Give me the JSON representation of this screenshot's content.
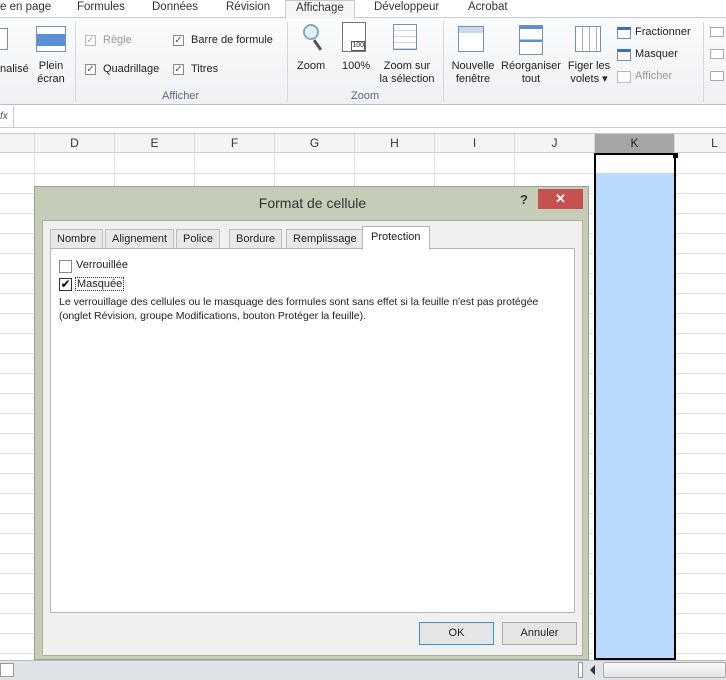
{
  "ribbon_tabs": [
    "e en page",
    "Formules",
    "Données",
    "Révision",
    "Affichage",
    "Développeur",
    "Acrobat"
  ],
  "active_tab": "Affichage",
  "ribbon": {
    "left_group": {
      "partial_label": "nalisé",
      "plein_ecran": [
        "Plein",
        "écran"
      ]
    },
    "afficher": {
      "label": "Afficher",
      "regle": {
        "label": "Règle",
        "checked": true,
        "disabled": true
      },
      "barre_formule": {
        "label": "Barre de formule",
        "checked": true
      },
      "quadrillage": {
        "label": "Quadrillage",
        "checked": true
      },
      "titres": {
        "label": "Titres",
        "checked": true
      }
    },
    "zoom": {
      "label": "Zoom",
      "zoom_btn": "Zoom",
      "pct_btn": "100%",
      "pct_icon_text": "100",
      "sel_btn": [
        "Zoom sur",
        "la sélection"
      ]
    },
    "fenetre": {
      "nouvelle": [
        "Nouvelle",
        "fenêtre"
      ],
      "reorganiser": [
        "Réorganiser",
        "tout"
      ],
      "figer": [
        "Figer les",
        "volets ▾"
      ],
      "fractionner": "Fractionner",
      "masquer": "Masquer",
      "afficher": "Afficher"
    }
  },
  "formula_bar": {
    "fx": "fx",
    "value": ""
  },
  "columns": [
    "D",
    "E",
    "F",
    "G",
    "H",
    "I",
    "J",
    "K",
    "L"
  ],
  "selected_column": "K",
  "dialog": {
    "title": "Format de cellule",
    "help": "?",
    "close": "✕",
    "tabs": [
      "Nombre",
      "Alignement",
      "Police",
      "Bordure",
      "Remplissage",
      "Protection"
    ],
    "active_tab": "Protection",
    "verrouillee": {
      "label": "Verrouillée",
      "checked": false
    },
    "masquee": {
      "label": "Masquée",
      "checked": true
    },
    "note_line1": "Le verrouillage des cellules ou le masquage des formules sont sans effet si la feuille n'est pas protégée",
    "note_line2": "(onglet Révision, groupe Modifications, bouton Protéger la feuille).",
    "ok": "OK",
    "cancel": "Annuler"
  }
}
